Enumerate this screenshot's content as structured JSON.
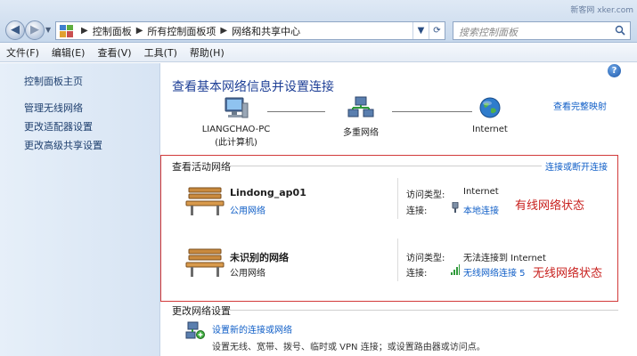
{
  "address_bar": {
    "breadcrumbs": [
      "控制面板",
      "所有控制面板项",
      "网络和共享中心"
    ],
    "search_placeholder": "搜索控制面板",
    "watermark": "新客网 xker.com"
  },
  "menu": [
    "文件(F)",
    "编辑(E)",
    "查看(V)",
    "工具(T)",
    "帮助(H)"
  ],
  "sidebar": {
    "items": [
      {
        "label": "控制面板主页"
      },
      {
        "label": "管理无线网络"
      },
      {
        "label": "更改适配器设置"
      },
      {
        "label": "更改高级共享设置"
      }
    ]
  },
  "main": {
    "title": "查看基本网络信息并设置连接",
    "full_map_link": "查看完整映射",
    "map": {
      "computer_name": "LIANGCHAO-PC",
      "computer_sub": "(此计算机)",
      "multi_network": "多重网络",
      "internet": "Internet"
    },
    "active": {
      "header": "查看活动网络",
      "connect_link": "连接或断开连接",
      "networks": [
        {
          "name": "Lindong_ap01",
          "type": "公用网络",
          "access_label": "访问类型:",
          "access_value": "Internet",
          "conn_label": "连接:",
          "conn_value": "本地连接",
          "annotation": "有线网络状态"
        },
        {
          "name": "未识别的网络",
          "type": "公用网络",
          "access_label": "访问类型:",
          "access_value": "无法连接到 Internet",
          "conn_label": "连接:",
          "conn_value": "无线网络连接 5",
          "annotation": "无线网络状态"
        }
      ]
    },
    "change": {
      "header": "更改网络设置",
      "setup_link": "设置新的连接或网络",
      "setup_desc": "设置无线、宽带、拨号、临时或 VPN 连接；或设置路由器或访问点。"
    }
  },
  "colors": {
    "link": "#0f5ec7",
    "title": "#1e3f96",
    "annotation": "#c8201e",
    "highlight_border": "#d23a3a"
  }
}
